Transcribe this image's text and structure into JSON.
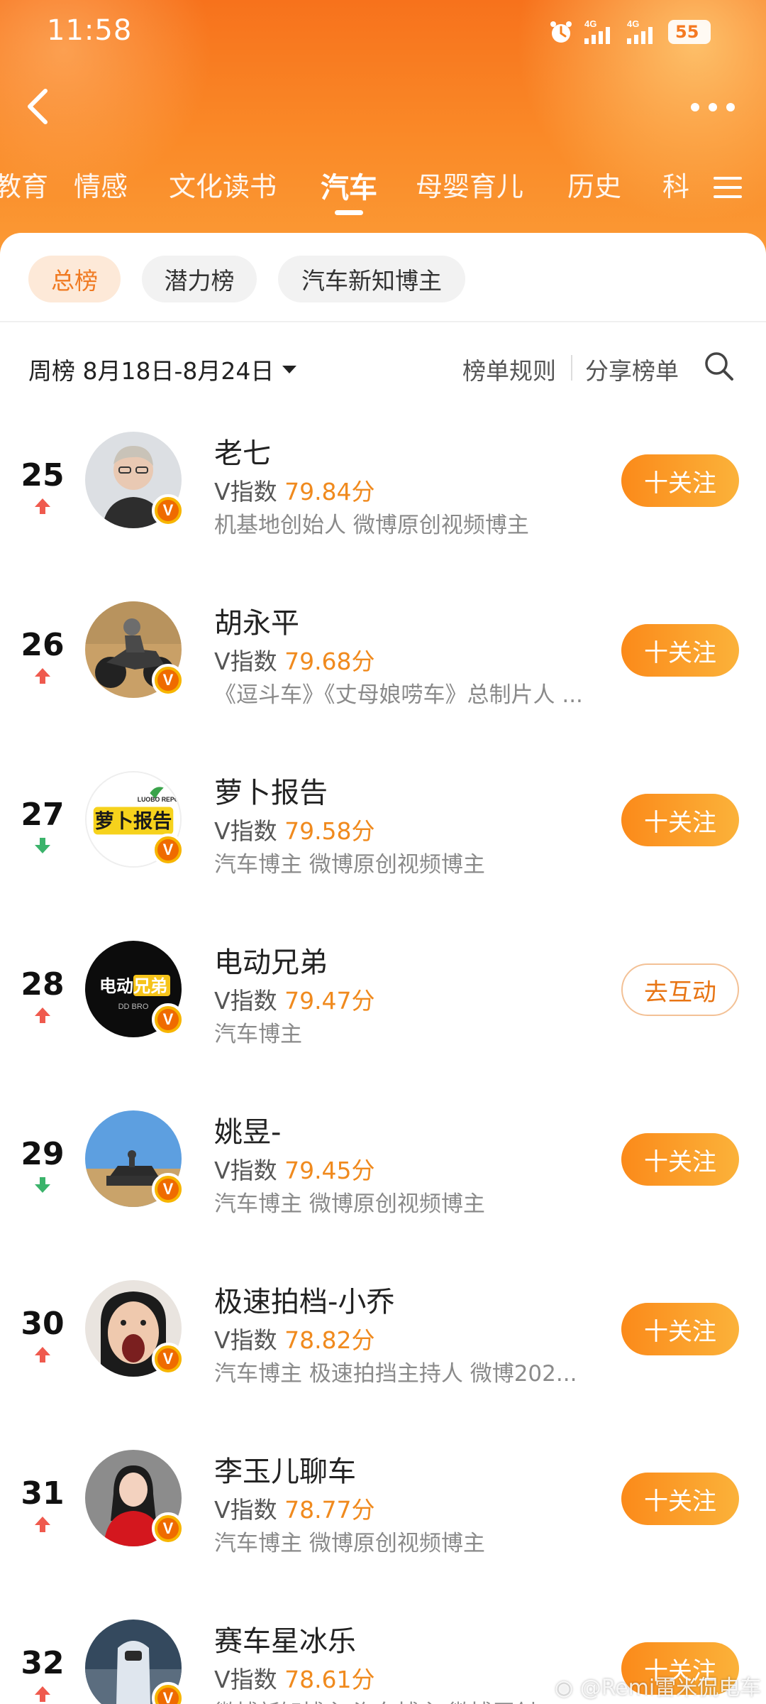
{
  "status_bar": {
    "time": "11:58",
    "network1": "4G",
    "network2": "4G",
    "battery": "55"
  },
  "tabs": [
    {
      "label": "教育",
      "active": false
    },
    {
      "label": "情感",
      "active": false
    },
    {
      "label": "文化读书",
      "active": false
    },
    {
      "label": "汽车",
      "active": true
    },
    {
      "label": "母婴育儿",
      "active": false
    },
    {
      "label": "历史",
      "active": false
    },
    {
      "label": "科",
      "active": false
    }
  ],
  "subtabs": [
    {
      "label": "总榜",
      "active": true
    },
    {
      "label": "潜力榜",
      "active": false
    },
    {
      "label": "汽车新知博主",
      "active": false
    }
  ],
  "filter": {
    "period": "周榜 8月18日-8月24日",
    "rules": "榜单规则",
    "share": "分享榜单"
  },
  "colors": {
    "accent": "#f7721c",
    "score": "#f08a1e",
    "badge": "#f7b500"
  },
  "rows": [
    {
      "rank": "25",
      "trend": "up",
      "name": "老七",
      "v_label": "V指数",
      "score": "79.84分",
      "desc": "机基地创始人 微博原创视频博主",
      "button": "十关注",
      "button_type": "follow",
      "avatar": "person-glasses"
    },
    {
      "rank": "26",
      "trend": "up",
      "name": "胡永平",
      "v_label": "V指数",
      "score": "79.68分",
      "desc": "《逗斗车》《丈母娘唠车》总制片人 ...",
      "button": "十关注",
      "button_type": "follow",
      "avatar": "motorcycle-rider"
    },
    {
      "rank": "27",
      "trend": "down",
      "name": "萝卜报告",
      "v_label": "V指数",
      "score": "79.58分",
      "desc": "汽车博主 微博原创视频博主",
      "button": "十关注",
      "button_type": "follow",
      "avatar": "luobo-logo"
    },
    {
      "rank": "28",
      "trend": "up",
      "name": "电动兄弟",
      "v_label": "V指数",
      "score": "79.47分",
      "desc": "汽车博主",
      "button": "去互动",
      "button_type": "interact",
      "avatar": "ddbro-logo"
    },
    {
      "rank": "29",
      "trend": "down",
      "name": "姚昱-",
      "v_label": "V指数",
      "score": "79.45分",
      "desc": "汽车博主 微博原创视频博主",
      "button": "十关注",
      "button_type": "follow",
      "avatar": "car-desert"
    },
    {
      "rank": "30",
      "trend": "up",
      "name": "极速拍档-小乔",
      "v_label": "V指数",
      "score": "78.82分",
      "desc": "汽车博主 极速拍挡主持人 微博202...",
      "button": "十关注",
      "button_type": "follow",
      "avatar": "woman-shouting"
    },
    {
      "rank": "31",
      "trend": "up",
      "name": "李玉儿聊车",
      "v_label": "V指数",
      "score": "78.77分",
      "desc": "汽车博主 微博原创视频博主",
      "button": "十关注",
      "button_type": "follow",
      "avatar": "woman-red"
    },
    {
      "rank": "32",
      "trend": "up",
      "name": "赛车星冰乐",
      "v_label": "V指数",
      "score": "78.61分",
      "desc": "微博新知博主 汽车博主 微博原创...",
      "button": "十关注",
      "button_type": "follow",
      "avatar": "race-driver"
    }
  ],
  "watermark": "@Remi雷米侃电车",
  "logos": {
    "luobo": "萝卜报告",
    "luobo_en": "LUOBO REPORT",
    "ddbro": "电动兄弟",
    "ddbro_en": "DD BRO"
  }
}
